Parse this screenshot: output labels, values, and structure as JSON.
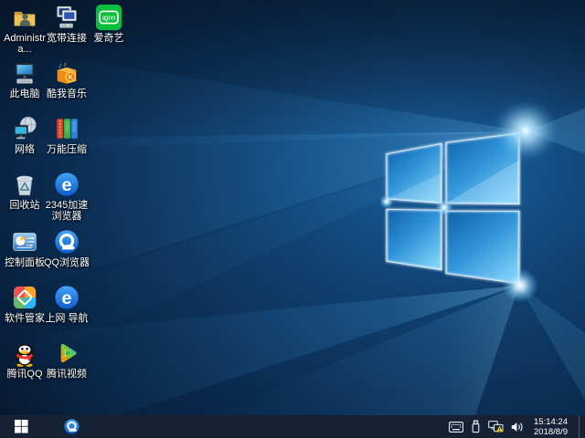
{
  "desktop": {
    "icons": [
      {
        "label": "Administra...",
        "icon": "user-folder"
      },
      {
        "label": "宽带连接",
        "icon": "broadband-connection"
      },
      {
        "label": "爱奇艺",
        "icon": "iqiyi"
      },
      {
        "label": "此电脑",
        "icon": "this-pc"
      },
      {
        "label": "酷我音乐",
        "icon": "kuwo-music"
      },
      {
        "label": "网络",
        "icon": "network"
      },
      {
        "label": "万能压缩",
        "icon": "compression-tool"
      },
      {
        "label": "回收站",
        "icon": "recycle-bin"
      },
      {
        "label": "2345加速浏览器",
        "icon": "2345-browser"
      },
      {
        "label": "控制面板",
        "icon": "control-panel"
      },
      {
        "label": "QQ浏览器",
        "icon": "qq-browser"
      },
      {
        "label": "软件管家",
        "icon": "software-manager"
      },
      {
        "label": "上网 导航",
        "icon": "web-navigation"
      },
      {
        "label": "腾讯QQ",
        "icon": "tencent-qq"
      },
      {
        "label": "腾讯视频",
        "icon": "tencent-video"
      }
    ]
  },
  "icon_glyphs": {
    "iqiyi": "iQIYI",
    "browser_e": "e",
    "kuwo_k": "K"
  },
  "taskbar": {
    "start": "start-button",
    "pinned": [
      "qq-browser"
    ],
    "tray_icons": [
      "touch-keyboard",
      "usb-device",
      "network-status-warning",
      "volume"
    ],
    "clock": {
      "time": "15:14:24",
      "date": "2018/8/9"
    }
  },
  "colors": {
    "taskbar_bg": "#152236",
    "wallpaper_base": "#0b2642",
    "wallpaper_beam": "#66c2f5",
    "iqiyi_green": "#0bbe3c",
    "qq_scarf_red": "#e6332a",
    "warning_yellow": "#f3c51c"
  }
}
